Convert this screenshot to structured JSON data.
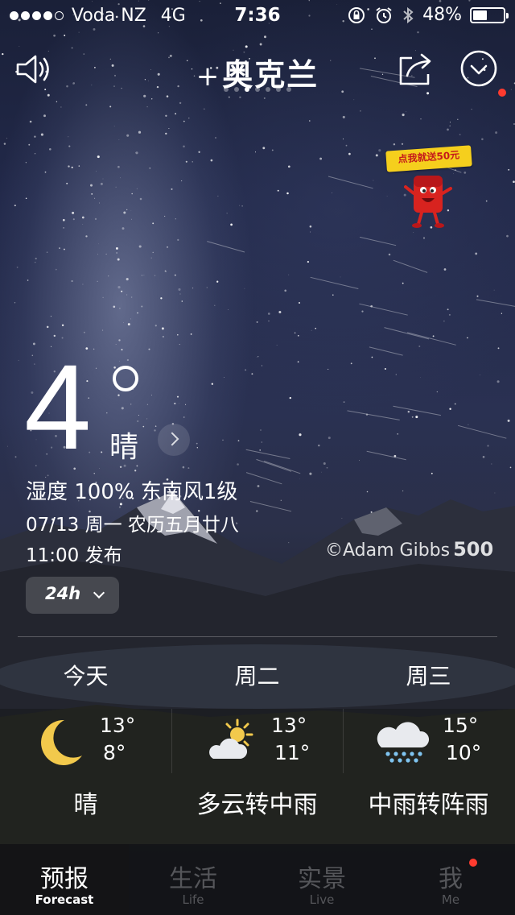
{
  "status_bar": {
    "carrier": "Voda NZ",
    "network": "4G",
    "time": "7:36",
    "battery": "48%",
    "battery_level": 0.48
  },
  "header": {
    "city_prefix": "+",
    "city": "奥克兰",
    "page_count": 7,
    "active_page": 2,
    "icons": [
      "speaker-icon",
      "share-icon",
      "chevron-circle-icon"
    ]
  },
  "promo": {
    "text": "点我就送50元"
  },
  "current": {
    "temperature": "4",
    "condition": "晴",
    "humidity_wind": "湿度 100% 东南风1级",
    "date_line": "07/13 周一 农历五月廿八",
    "published": "11:00 发布",
    "photo_credit": "©Adam Gibbs",
    "photo_source": "500"
  },
  "hourly_button": {
    "label": "24h"
  },
  "forecast": [
    {
      "day": "今天",
      "high": "13°",
      "low": "8°",
      "condition": "晴",
      "icon": "moon-icon"
    },
    {
      "day": "周二",
      "high": "13°",
      "low": "11°",
      "condition": "多云转中雨",
      "icon": "partly-cloudy-icon"
    },
    {
      "day": "周三",
      "high": "15°",
      "low": "10°",
      "condition": "中雨转阵雨",
      "icon": "rain-cloud-icon"
    }
  ],
  "tabs": [
    {
      "cn": "预报",
      "en": "Forecast",
      "active": true
    },
    {
      "cn": "生活",
      "en": "Life",
      "active": false
    },
    {
      "cn": "实景",
      "en": "Live",
      "active": false
    },
    {
      "cn": "我",
      "en": "Me",
      "active": false,
      "badge": true
    }
  ],
  "colors": {
    "accent_badge": "#ff3b2f",
    "promo_yellow": "#f5cf1d",
    "promo_red": "#d8231f",
    "moon": "#f2c94c"
  }
}
